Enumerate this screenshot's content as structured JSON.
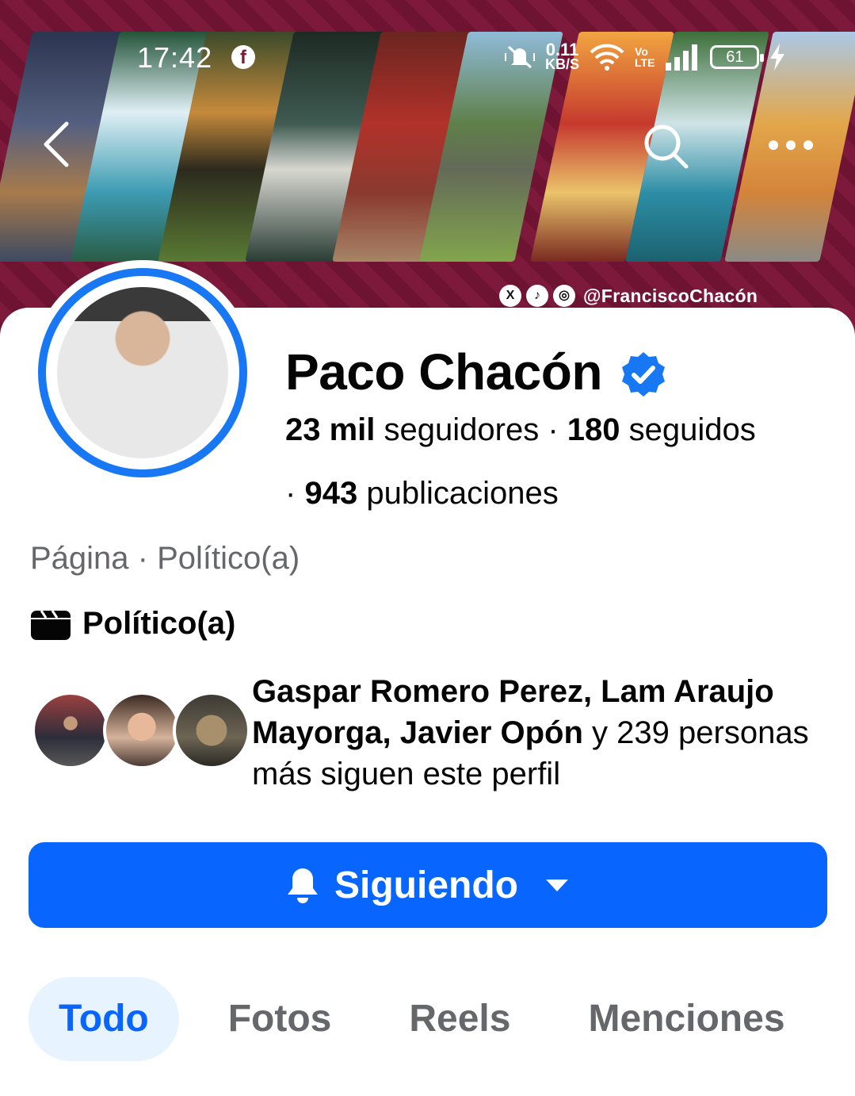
{
  "status_bar": {
    "time": "17:42",
    "data_speed_value": "0.11",
    "data_speed_unit": "KB/S",
    "volte_top": "Vo",
    "volte_bottom": "LTE",
    "battery": "61"
  },
  "cover": {
    "social_handle": "@FranciscoChacón",
    "social_icons": [
      "x-icon",
      "tiktok-icon",
      "instagram-icon"
    ]
  },
  "profile": {
    "name": "Paco Chacón",
    "followers_count": "23 mil",
    "followers_label": "seguidores",
    "following_count": "180",
    "following_label": "seguidos",
    "posts_count": "943",
    "posts_label": "publicaciones",
    "page_type": "Página · Político(a)",
    "category": "Político(a)"
  },
  "mutual": {
    "names": "Gaspar Romero Perez, Lam Araujo Mayorga, Javier Opón",
    "suffix_count": "y 239",
    "suffix_text": "personas más siguen este perfil"
  },
  "follow_button": {
    "label": "Siguiendo"
  },
  "tabs": [
    {
      "label": "Todo",
      "active": true
    },
    {
      "label": "Fotos",
      "active": false
    },
    {
      "label": "Reels",
      "active": false
    },
    {
      "label": "Menciones",
      "active": false
    }
  ],
  "colors": {
    "brand_blue": "#0866ff",
    "ring_blue": "#1877f2",
    "cover_maroon": "#7d1a3c",
    "muted_text": "#65676b"
  }
}
